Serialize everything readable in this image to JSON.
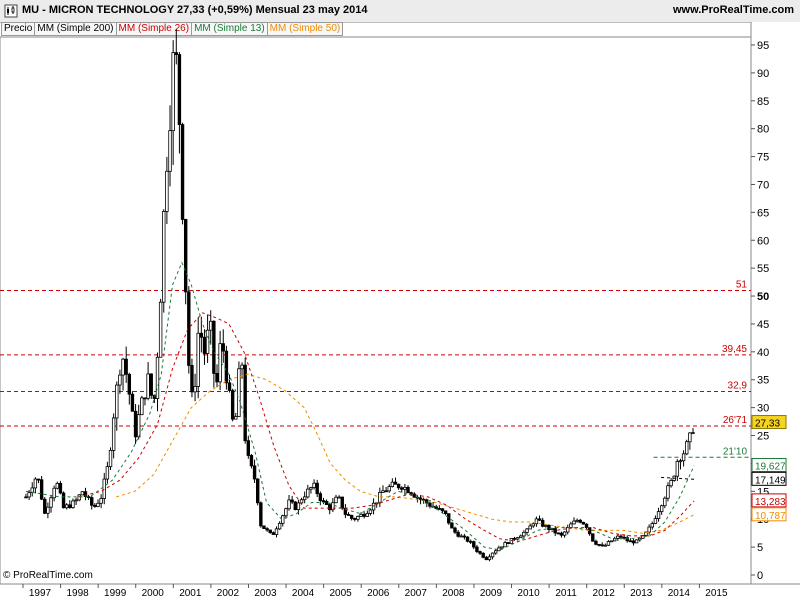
{
  "header": {
    "title": "MU - MICRON TECHNOLOGY    27,33 (+0,59%)    Mensual  23 may 2014",
    "site": "www.ProRealTime.com"
  },
  "legend": [
    {
      "label": "Precio",
      "color": "#000000"
    },
    {
      "label": "MM (Simple 200)",
      "color": "#000000"
    },
    {
      "label": "MM (Simple 26)",
      "color": "#cc0000"
    },
    {
      "label": "MM (Simple 13)",
      "color": "#1a7a3a"
    },
    {
      "label": "MM (Simple 50)",
      "color": "#f08c00"
    }
  ],
  "copyright": "© ProRealTime.com",
  "chart_data": {
    "type": "candlestick",
    "frequency": "monthly",
    "xlim": [
      1996.5,
      2015.6
    ],
    "ylim": [
      0,
      98
    ],
    "x_ticks": [
      "1997",
      "1998",
      "1999",
      "2000",
      "2001",
      "2002",
      "2003",
      "2004",
      "2005",
      "2006",
      "2007",
      "2008",
      "2009",
      "2010",
      "2011",
      "2012",
      "2013",
      "2014",
      "2015"
    ],
    "y_ticks": [
      0,
      5,
      10,
      15,
      20,
      25,
      30,
      35,
      40,
      45,
      50,
      55,
      60,
      65,
      70,
      75,
      80,
      85,
      90,
      95
    ],
    "price_path": [
      [
        1996.6,
        14
      ],
      [
        1996.9,
        18
      ],
      [
        1997.1,
        11
      ],
      [
        1997.4,
        17
      ],
      [
        1997.6,
        12
      ],
      [
        1997.9,
        13
      ],
      [
        1998.1,
        15
      ],
      [
        1998.4,
        12
      ],
      [
        1998.6,
        14
      ],
      [
        1998.8,
        20
      ],
      [
        1998.95,
        30
      ],
      [
        1999.15,
        40
      ],
      [
        1999.3,
        35
      ],
      [
        1999.5,
        25
      ],
      [
        1999.65,
        30
      ],
      [
        1999.85,
        35
      ],
      [
        2000.0,
        30
      ],
      [
        2000.15,
        45
      ],
      [
        2000.3,
        70
      ],
      [
        2000.45,
        85
      ],
      [
        2000.55,
        95
      ],
      [
        2000.65,
        88
      ],
      [
        2000.8,
        60
      ],
      [
        2000.95,
        35
      ],
      [
        2001.05,
        30
      ],
      [
        2001.2,
        45
      ],
      [
        2001.35,
        40
      ],
      [
        2001.5,
        45
      ],
      [
        2001.65,
        32
      ],
      [
        2001.8,
        43
      ],
      [
        2001.95,
        35
      ],
      [
        2002.05,
        30
      ],
      [
        2002.15,
        25
      ],
      [
        2002.25,
        35
      ],
      [
        2002.35,
        38
      ],
      [
        2002.45,
        22
      ],
      [
        2002.55,
        20
      ],
      [
        2002.7,
        17
      ],
      [
        2002.85,
        9
      ],
      [
        2003.0,
        8
      ],
      [
        2003.15,
        7
      ],
      [
        2003.3,
        9
      ],
      [
        2003.45,
        11
      ],
      [
        2003.6,
        13
      ],
      [
        2003.8,
        12
      ],
      [
        2003.95,
        14
      ],
      [
        2004.1,
        15
      ],
      [
        2004.25,
        16
      ],
      [
        2004.5,
        13
      ],
      [
        2004.7,
        12
      ],
      [
        2004.9,
        14
      ],
      [
        2005.1,
        11
      ],
      [
        2005.3,
        10
      ],
      [
        2005.6,
        11
      ],
      [
        2005.9,
        13
      ],
      [
        2006.1,
        15
      ],
      [
        2006.35,
        16
      ],
      [
        2006.6,
        16
      ],
      [
        2006.85,
        15
      ],
      [
        2007.0,
        14
      ],
      [
        2007.25,
        13
      ],
      [
        2007.5,
        12
      ],
      [
        2007.75,
        11
      ],
      [
        2007.95,
        8
      ],
      [
        2008.15,
        7
      ],
      [
        2008.4,
        6
      ],
      [
        2008.65,
        4
      ],
      [
        2008.85,
        3
      ],
      [
        2009.0,
        4
      ],
      [
        2009.2,
        5
      ],
      [
        2009.45,
        6
      ],
      [
        2009.7,
        7
      ],
      [
        2009.95,
        8
      ],
      [
        2010.15,
        10
      ],
      [
        2010.35,
        9
      ],
      [
        2010.6,
        8
      ],
      [
        2010.85,
        7
      ],
      [
        2011.1,
        9
      ],
      [
        2011.3,
        10
      ],
      [
        2011.5,
        9
      ],
      [
        2011.7,
        6
      ],
      [
        2011.95,
        5
      ],
      [
        2012.15,
        6
      ],
      [
        2012.4,
        7
      ],
      [
        2012.65,
        6
      ],
      [
        2012.85,
        6
      ],
      [
        2013.05,
        7
      ],
      [
        2013.25,
        9
      ],
      [
        2013.45,
        12
      ],
      [
        2013.65,
        15
      ],
      [
        2013.8,
        17
      ],
      [
        2013.95,
        21
      ],
      [
        2014.1,
        22
      ],
      [
        2014.25,
        24
      ],
      [
        2014.38,
        27.33
      ]
    ],
    "ma13_path": [
      [
        1996.6,
        15
      ],
      [
        1997.5,
        14
      ],
      [
        1998.3,
        14
      ],
      [
        1998.9,
        17
      ],
      [
        1999.4,
        22
      ],
      [
        1999.9,
        29
      ],
      [
        2000.2,
        36
      ],
      [
        2000.5,
        52
      ],
      [
        2000.75,
        56
      ],
      [
        2001.0,
        52
      ],
      [
        2001.3,
        45
      ],
      [
        2001.6,
        40
      ],
      [
        2002.0,
        36
      ],
      [
        2002.3,
        31
      ],
      [
        2002.7,
        22
      ],
      [
        2003.0,
        13
      ],
      [
        2003.4,
        10
      ],
      [
        2003.8,
        11
      ],
      [
        2004.2,
        13
      ],
      [
        2004.6,
        13
      ],
      [
        2005.0,
        12
      ],
      [
        2005.5,
        11
      ],
      [
        2006.0,
        13
      ],
      [
        2006.5,
        15
      ],
      [
        2007.0,
        14
      ],
      [
        2007.5,
        12
      ],
      [
        2007.9,
        10
      ],
      [
        2008.3,
        8
      ],
      [
        2008.8,
        5
      ],
      [
        2009.2,
        4.5
      ],
      [
        2009.7,
        6
      ],
      [
        2010.2,
        8
      ],
      [
        2010.7,
        8.5
      ],
      [
        2011.2,
        8.5
      ],
      [
        2011.7,
        8
      ],
      [
        2012.2,
        6.5
      ],
      [
        2012.7,
        6.5
      ],
      [
        2013.2,
        7
      ],
      [
        2013.6,
        9.5
      ],
      [
        2014.0,
        14
      ],
      [
        2014.38,
        19.6
      ]
    ],
    "ma26_path": [
      [
        1998.0,
        14
      ],
      [
        1998.6,
        15
      ],
      [
        1999.1,
        17
      ],
      [
        1999.6,
        21
      ],
      [
        2000.1,
        27
      ],
      [
        2000.5,
        37
      ],
      [
        2000.9,
        44
      ],
      [
        2001.3,
        47
      ],
      [
        2001.7,
        46
      ],
      [
        2002.0,
        45
      ],
      [
        2002.4,
        40
      ],
      [
        2002.8,
        32
      ],
      [
        2003.2,
        23
      ],
      [
        2003.6,
        16
      ],
      [
        2004.0,
        12
      ],
      [
        2004.4,
        12
      ],
      [
        2004.8,
        12
      ],
      [
        2005.3,
        12
      ],
      [
        2005.8,
        12.5
      ],
      [
        2006.3,
        13.5
      ],
      [
        2006.8,
        14.5
      ],
      [
        2007.3,
        14
      ],
      [
        2007.8,
        12.5
      ],
      [
        2008.3,
        10
      ],
      [
        2008.8,
        8
      ],
      [
        2009.2,
        6.5
      ],
      [
        2009.7,
        6
      ],
      [
        2010.2,
        7
      ],
      [
        2010.7,
        8
      ],
      [
        2011.2,
        8.5
      ],
      [
        2011.7,
        8.5
      ],
      [
        2012.2,
        7.5
      ],
      [
        2012.7,
        7
      ],
      [
        2013.2,
        7
      ],
      [
        2013.6,
        8
      ],
      [
        2014.0,
        10.5
      ],
      [
        2014.38,
        13.3
      ]
    ],
    "ma50_path": [
      [
        1999.0,
        14
      ],
      [
        1999.5,
        15
      ],
      [
        2000.0,
        18
      ],
      [
        2000.5,
        24
      ],
      [
        2001.0,
        30
      ],
      [
        2001.5,
        33
      ],
      [
        2002.0,
        35
      ],
      [
        2002.5,
        36
      ],
      [
        2003.0,
        35
      ],
      [
        2003.5,
        33
      ],
      [
        2004.0,
        30
      ],
      [
        2004.3,
        26
      ],
      [
        2004.7,
        20
      ],
      [
        2005.1,
        17
      ],
      [
        2005.5,
        15
      ],
      [
        2006.0,
        14
      ],
      [
        2006.5,
        14
      ],
      [
        2007.0,
        13.5
      ],
      [
        2007.5,
        13
      ],
      [
        2008.0,
        12
      ],
      [
        2008.5,
        11
      ],
      [
        2009.0,
        10
      ],
      [
        2009.5,
        9.5
      ],
      [
        2010.0,
        9.5
      ],
      [
        2010.5,
        9
      ],
      [
        2011.0,
        8.5
      ],
      [
        2011.5,
        8
      ],
      [
        2012.0,
        8
      ],
      [
        2012.5,
        8
      ],
      [
        2013.0,
        7.5
      ],
      [
        2013.5,
        8
      ],
      [
        2014.0,
        9.5
      ],
      [
        2014.38,
        10.8
      ]
    ],
    "ma200_path": [
      [
        2013.5,
        17.5
      ],
      [
        2014.38,
        17.15
      ]
    ],
    "h_levels": [
      {
        "label": "51",
        "y": 51,
        "color": "#cc0000"
      },
      {
        "label": "39,45",
        "y": 39.45,
        "color": "#cc0000"
      },
      {
        "label": "32,9",
        "y": 32.9,
        "color": "#cc0000"
      },
      {
        "label": "26'71",
        "y": 26.71,
        "color": "#cc0000"
      },
      {
        "label": "21'10",
        "y": 21.1,
        "color": "#1a7a3a"
      }
    ],
    "value_boxes": [
      {
        "label": "27,33",
        "y": 27.33,
        "bg": "#f5d320",
        "fg": "#000000",
        "border": "#8a7a00"
      },
      {
        "label": "19,627",
        "y": 19.627,
        "bg": "#ffffff",
        "fg": "#1a7a3a",
        "border": "#1a7a3a"
      },
      {
        "label": "17,149",
        "y": 17.149,
        "bg": "#ffffff",
        "fg": "#000000",
        "border": "#000000"
      },
      {
        "label": "13,283",
        "y": 13.283,
        "bg": "#ffffff",
        "fg": "#cc0000",
        "border": "#cc0000"
      },
      {
        "label": "10,787",
        "y": 10.787,
        "bg": "#ffffff",
        "fg": "#f08c00",
        "border": "#f08c00"
      }
    ],
    "colors": {
      "price": "#000000",
      "ma13": "#1a7a3a",
      "ma26": "#cc0000",
      "ma50": "#f08c00",
      "ma200": "#000000",
      "grid": "#d0d0d0"
    }
  }
}
